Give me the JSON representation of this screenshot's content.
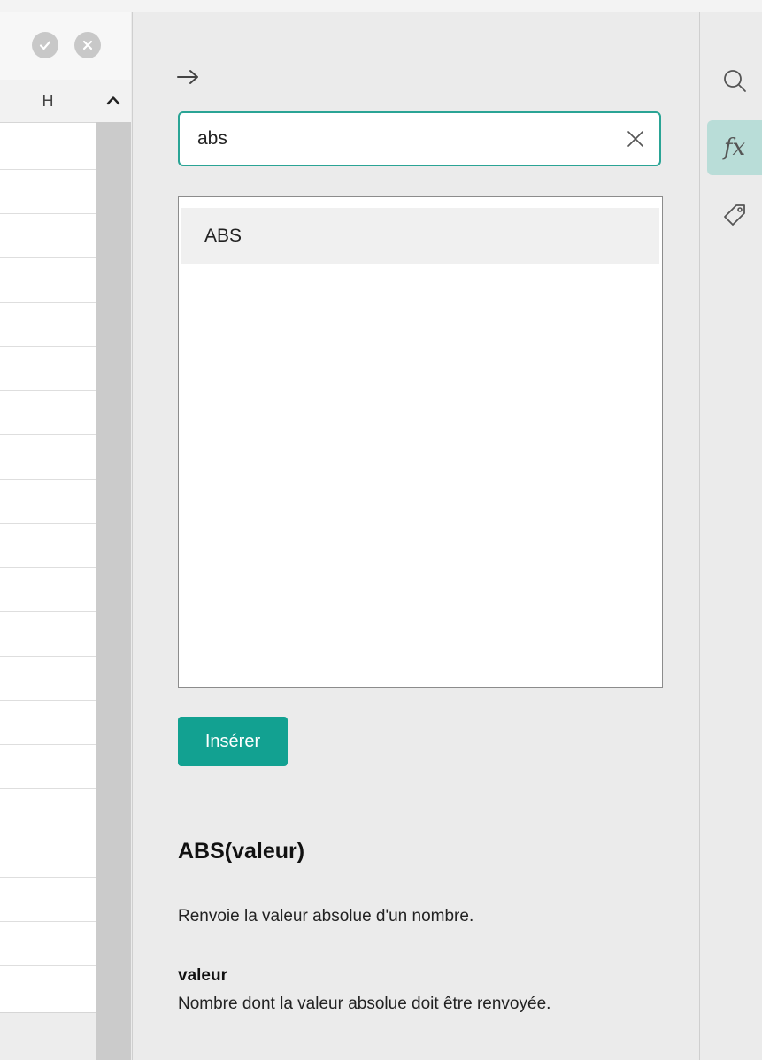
{
  "function_panel": {
    "search": {
      "value": "abs",
      "placeholder": ""
    },
    "results": [
      "ABS"
    ],
    "insert_label": "Insérer",
    "syntax": "ABS(valeur)",
    "description": "Renvoie la valeur absolue d'un nombre.",
    "param_name": "valeur",
    "param_description": "Nombre dont la valeur absolue doit être renvoyée."
  },
  "sheet": {
    "column_header": "H"
  },
  "icons": {
    "confirm": "check-icon",
    "cancel": "close-icon",
    "back": "arrow-right-icon",
    "clear": "clear-icon",
    "search_tab": "search-icon",
    "functions_tab": "fx-icon",
    "tags_tab": "tag-icon"
  },
  "colors": {
    "accent": "#12a191",
    "search_border": "#2aa495",
    "active_tab": "#b9ddd8"
  }
}
